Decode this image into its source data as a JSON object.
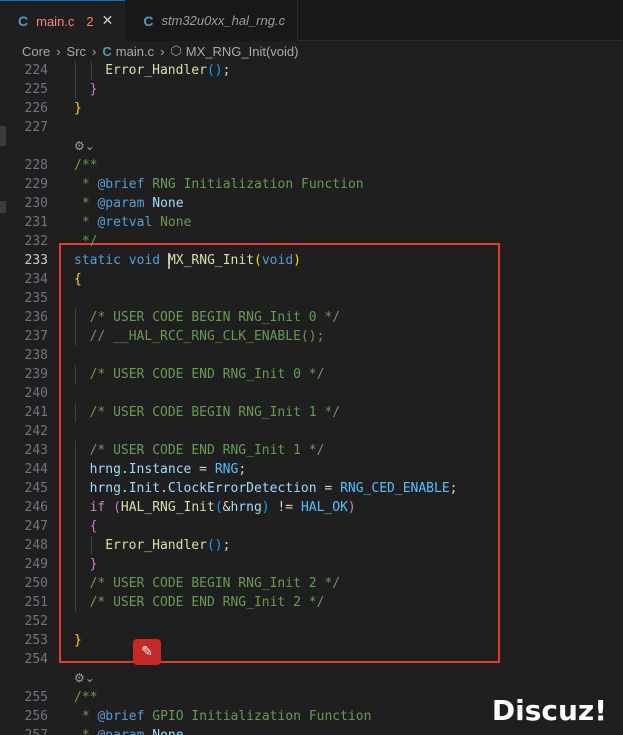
{
  "tabs": [
    {
      "icon": "C",
      "name": "main.c",
      "badge": "2",
      "close": "✕",
      "active": true
    },
    {
      "icon": "C",
      "name": "stm32u0xx_hal_rng.c",
      "active": false
    }
  ],
  "breadcrumb": {
    "items": [
      "Core",
      "Src",
      "main.c",
      "MX_RNG_Init(void)"
    ],
    "file_icon": "C",
    "symbol_icon": "⬡",
    "separator": "›"
  },
  "editor": {
    "lens_icon": "⚙⌄",
    "current_line": 233,
    "lines": [
      {
        "n": 224,
        "tokens": [
          [
            "fn",
            "Error_Handler"
          ],
          [
            "p3",
            "("
          ],
          [
            "p3",
            ")"
          ],
          [
            "def",
            ";"
          ]
        ],
        "indent": 4
      },
      {
        "n": 225,
        "tokens": [
          [
            "p2",
            "}"
          ]
        ],
        "indent": 2
      },
      {
        "n": 226,
        "tokens": [
          [
            "p1",
            "}"
          ]
        ],
        "indent": 0
      },
      {
        "n": 227,
        "tokens": [],
        "indent": 0
      },
      {
        "n": 228,
        "tokens": [
          [
            "cm",
            "/**"
          ]
        ],
        "indent": 0,
        "lens": true
      },
      {
        "n": 229,
        "tokens": [
          [
            "cm",
            " * "
          ],
          [
            "doc",
            "@brief"
          ],
          [
            "cm",
            " RNG Initialization Function"
          ]
        ],
        "indent": 0
      },
      {
        "n": 230,
        "tokens": [
          [
            "cm",
            " * "
          ],
          [
            "doc",
            "@param"
          ],
          [
            "var",
            " None"
          ]
        ],
        "indent": 0
      },
      {
        "n": 231,
        "tokens": [
          [
            "cm",
            " * "
          ],
          [
            "doc",
            "@retval"
          ],
          [
            "cm",
            " None"
          ]
        ],
        "indent": 0
      },
      {
        "n": 232,
        "tokens": [
          [
            "cm",
            " */"
          ]
        ],
        "indent": 0
      },
      {
        "n": 233,
        "tokens": [
          [
            "kw",
            "static"
          ],
          [
            "def",
            " "
          ],
          [
            "kw",
            "void"
          ],
          [
            "def",
            " "
          ],
          [
            "cursor",
            ""
          ],
          [
            "fn",
            "MX_RNG_Init"
          ],
          [
            "p1",
            "("
          ],
          [
            "kw",
            "void"
          ],
          [
            "p1",
            ")"
          ]
        ],
        "indent": 0
      },
      {
        "n": 234,
        "tokens": [
          [
            "p1",
            "{"
          ]
        ],
        "indent": 0
      },
      {
        "n": 235,
        "tokens": [],
        "indent": 0
      },
      {
        "n": 236,
        "tokens": [
          [
            "cm",
            "/* USER CODE BEGIN RNG_Init 0 */"
          ]
        ],
        "indent": 2
      },
      {
        "n": 237,
        "tokens": [
          [
            "cm",
            "// __HAL_RCC_RNG_CLK_ENABLE();"
          ]
        ],
        "indent": 2
      },
      {
        "n": 238,
        "tokens": [],
        "indent": 0
      },
      {
        "n": 239,
        "tokens": [
          [
            "cm",
            "/* USER CODE END RNG_Init 0 */"
          ]
        ],
        "indent": 2
      },
      {
        "n": 240,
        "tokens": [],
        "indent": 0
      },
      {
        "n": 241,
        "tokens": [
          [
            "cm",
            "/* USER CODE BEGIN RNG_Init 1 */"
          ]
        ],
        "indent": 2
      },
      {
        "n": 242,
        "tokens": [],
        "indent": 0
      },
      {
        "n": 243,
        "tokens": [
          [
            "cm",
            "/* USER CODE END RNG_Init 1 */"
          ]
        ],
        "indent": 2
      },
      {
        "n": 244,
        "tokens": [
          [
            "var",
            "hrng"
          ],
          [
            "def",
            "."
          ],
          [
            "var",
            "Instance"
          ],
          [
            "def",
            " = "
          ],
          [
            "mac",
            "RNG"
          ],
          [
            "def",
            ";"
          ]
        ],
        "indent": 2
      },
      {
        "n": 245,
        "tokens": [
          [
            "var",
            "hrng"
          ],
          [
            "def",
            "."
          ],
          [
            "var",
            "Init"
          ],
          [
            "def",
            "."
          ],
          [
            "var",
            "ClockErrorDetection"
          ],
          [
            "def",
            " = "
          ],
          [
            "mac",
            "RNG_CED_ENABLE"
          ],
          [
            "def",
            ";"
          ]
        ],
        "indent": 2
      },
      {
        "n": 246,
        "tokens": [
          [
            "ctl",
            "if"
          ],
          [
            "def",
            " "
          ],
          [
            "p2",
            "("
          ],
          [
            "fn",
            "HAL_RNG_Init"
          ],
          [
            "p3",
            "("
          ],
          [
            "def",
            "&"
          ],
          [
            "var",
            "hrng"
          ],
          [
            "p3",
            ")"
          ],
          [
            "def",
            " != "
          ],
          [
            "mac",
            "HAL_OK"
          ],
          [
            "p2",
            ")"
          ]
        ],
        "indent": 2
      },
      {
        "n": 247,
        "tokens": [
          [
            "p2",
            "{"
          ]
        ],
        "indent": 2
      },
      {
        "n": 248,
        "tokens": [
          [
            "fn",
            "Error_Handler"
          ],
          [
            "p3",
            "("
          ],
          [
            "p3",
            ")"
          ],
          [
            "def",
            ";"
          ]
        ],
        "indent": 4
      },
      {
        "n": 249,
        "tokens": [
          [
            "p2",
            "}"
          ]
        ],
        "indent": 2
      },
      {
        "n": 250,
        "tokens": [
          [
            "cm",
            "/* USER CODE BEGIN RNG_Init 2 */"
          ]
        ],
        "indent": 2
      },
      {
        "n": 251,
        "tokens": [
          [
            "cm",
            "/* USER CODE END RNG_Init 2 */"
          ]
        ],
        "indent": 2
      },
      {
        "n": 252,
        "tokens": [],
        "indent": 0
      },
      {
        "n": 253,
        "tokens": [
          [
            "p1",
            "}"
          ]
        ],
        "indent": 0
      },
      {
        "n": 254,
        "tokens": [],
        "indent": 0
      },
      {
        "n": 255,
        "tokens": [
          [
            "cm",
            "/**"
          ]
        ],
        "indent": 0,
        "lens": true
      },
      {
        "n": 256,
        "tokens": [
          [
            "cm",
            " * "
          ],
          [
            "doc",
            "@brief"
          ],
          [
            "cm",
            " GPIO Initialization Function"
          ]
        ],
        "indent": 0
      },
      {
        "n": 257,
        "tokens": [
          [
            "cm",
            " * "
          ],
          [
            "doc",
            "@param"
          ],
          [
            "var",
            " None"
          ]
        ],
        "indent": 0
      }
    ]
  },
  "float_button": {
    "icon": "✎"
  },
  "watermark": "Discuz!"
}
